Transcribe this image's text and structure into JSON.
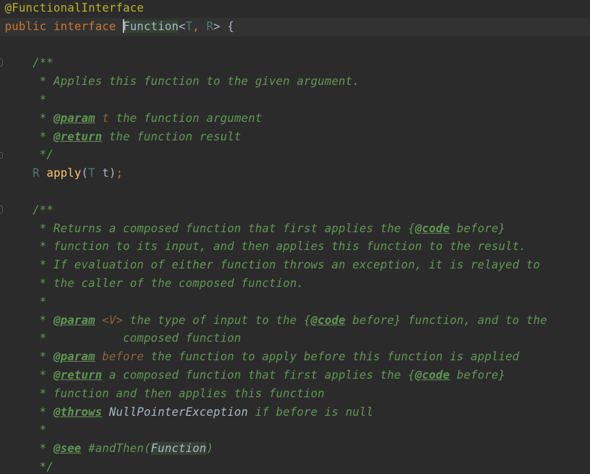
{
  "editor": {
    "lines": {
      "annotation": "@FunctionalInterface",
      "decl": {
        "kw1": "public ",
        "kw2": "interface ",
        "name": "Function",
        "lt": "<",
        "t": "T",
        "comma": ", ",
        "r": "R",
        "rest": "> {"
      },
      "doc1": {
        "open": "    /**",
        "l1": "     * Applies this function to the given argument.",
        "l2": "     *",
        "l3_pre": "     * ",
        "l3_tag": "@param",
        "l3_sp": " ",
        "l3_name": "t",
        "l3_text": " the function argument",
        "l4_pre": "     * ",
        "l4_tag": "@return",
        "l4_text": " the function result",
        "close": "     */"
      },
      "apply": {
        "indent": "    ",
        "ret": "R",
        "sp": " ",
        "name": "apply",
        "paren": "(",
        "t": "T",
        "rest": " t)",
        "semi": ";"
      },
      "doc2": {
        "open": "    /**",
        "l1_pre": "     * Returns a composed function that first applies the {",
        "l1_tag": "@code",
        "l1_post": " before}",
        "l2": "     * function to its input, and then applies this function to the result.",
        "l3": "     * If evaluation of either function throws an exception, it is relayed to",
        "l4": "     * the caller of the composed function.",
        "l5": "     *",
        "l6_pre": "     * ",
        "l6_tag": "@param",
        "l6_sp": " ",
        "l6_name": "<V>",
        "l6_mid": " the type of input to the {",
        "l6_tag2": "@code",
        "l6_post": " before} function, and to the",
        "l7": "     *           composed function",
        "l8_pre": "     * ",
        "l8_tag": "@param",
        "l8_sp": " ",
        "l8_name": "before",
        "l8_text": " the function to apply before this function is applied",
        "l9_pre": "     * ",
        "l9_tag": "@return",
        "l9_mid": " a composed function that first applies the {",
        "l9_tag2": "@code",
        "l9_post": " before}",
        "l10": "     * function and then applies this function",
        "l11_pre": "     * ",
        "l11_tag": "@throws",
        "l11_sp": " ",
        "l11_ref": "NullPointerException",
        "l11_text": " if before is null",
        "l12": "     *",
        "l13_pre": "     * ",
        "l13_tag": "@see",
        "l13_mid": " #andThen(",
        "l13_ref": "Function",
        "l13_post": ")",
        "close": "     */"
      }
    }
  }
}
